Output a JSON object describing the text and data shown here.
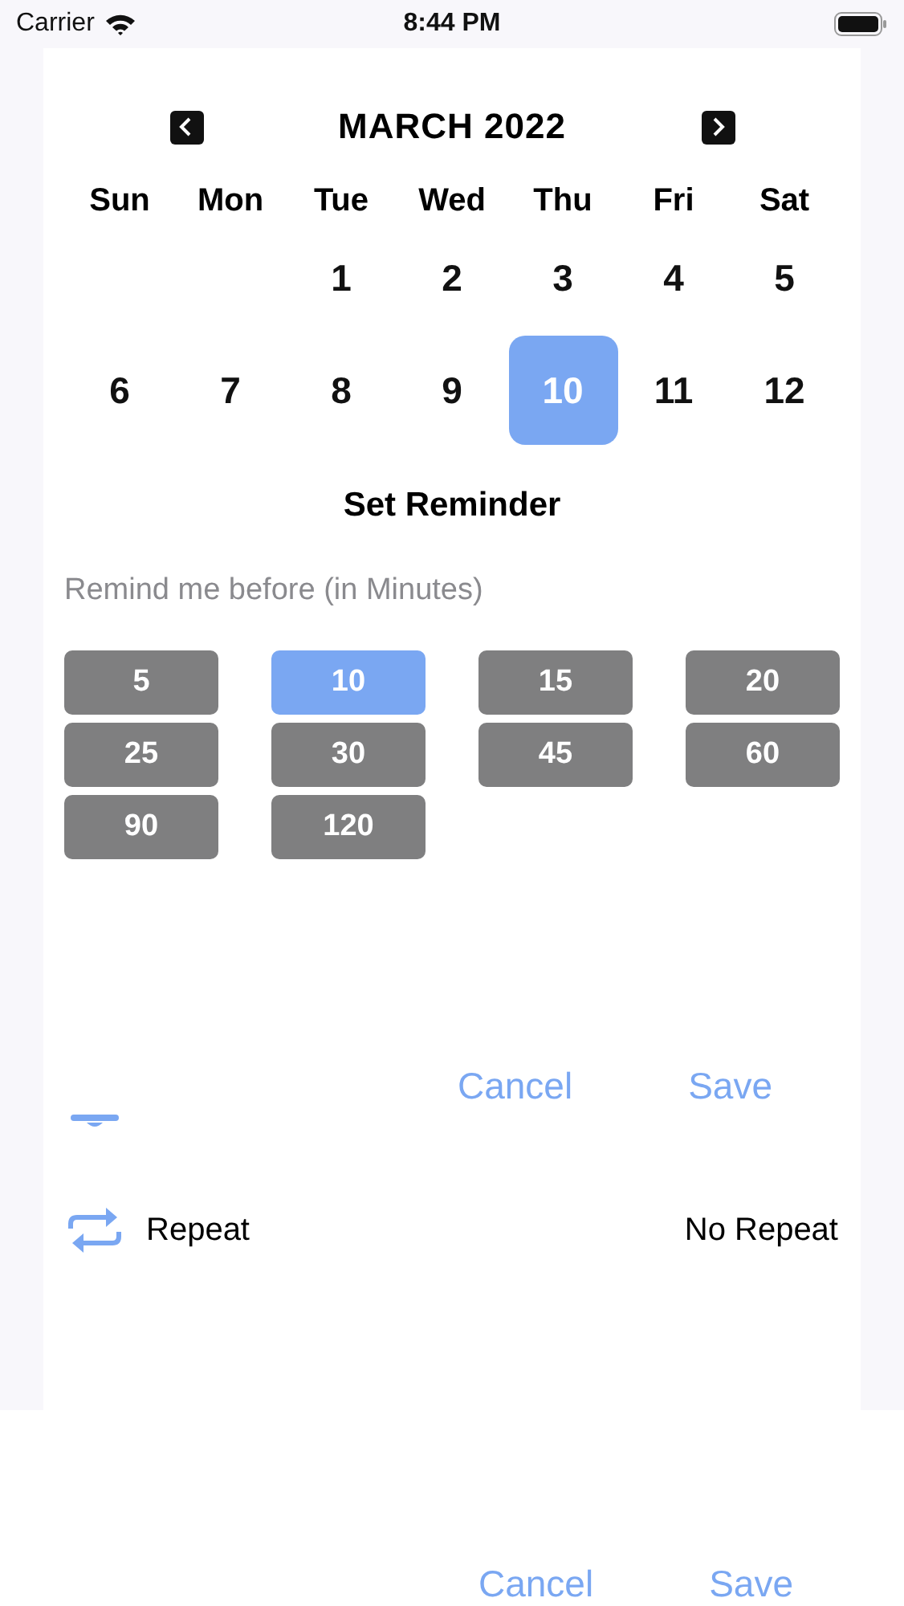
{
  "status_bar": {
    "carrier": "Carrier",
    "time": "8:44 PM"
  },
  "calendar": {
    "month": "MARCH 2022",
    "weekdays": [
      "Sun",
      "Mon",
      "Tue",
      "Wed",
      "Thu",
      "Fri",
      "Sat"
    ],
    "days": [
      {
        "label": "1",
        "selected": false
      },
      {
        "label": "2",
        "selected": false
      },
      {
        "label": "3",
        "selected": false
      },
      {
        "label": "4",
        "selected": false
      },
      {
        "label": "5",
        "selected": false
      },
      {
        "label": "6",
        "selected": false
      },
      {
        "label": "7",
        "selected": false
      },
      {
        "label": "8",
        "selected": false
      },
      {
        "label": "9",
        "selected": false
      },
      {
        "label": "10",
        "selected": true
      },
      {
        "label": "11",
        "selected": false
      },
      {
        "label": "12",
        "selected": false
      }
    ]
  },
  "reminder": {
    "title": "Set Reminder",
    "subtitle": "Remind me before (in Minutes)",
    "options": [
      {
        "label": "5",
        "selected": false
      },
      {
        "label": "10",
        "selected": true
      },
      {
        "label": "15",
        "selected": false
      },
      {
        "label": "20",
        "selected": false
      },
      {
        "label": "25",
        "selected": false
      },
      {
        "label": "30",
        "selected": false
      },
      {
        "label": "45",
        "selected": false
      },
      {
        "label": "60",
        "selected": false
      },
      {
        "label": "90",
        "selected": false
      },
      {
        "label": "120",
        "selected": false
      }
    ],
    "buttons": [
      "Cancel",
      "Save"
    ]
  },
  "rows": [
    {
      "label": "Repeat",
      "value": "No Repeat"
    }
  ],
  "bottom_buttons": [
    "Cancel",
    "Save"
  ]
}
